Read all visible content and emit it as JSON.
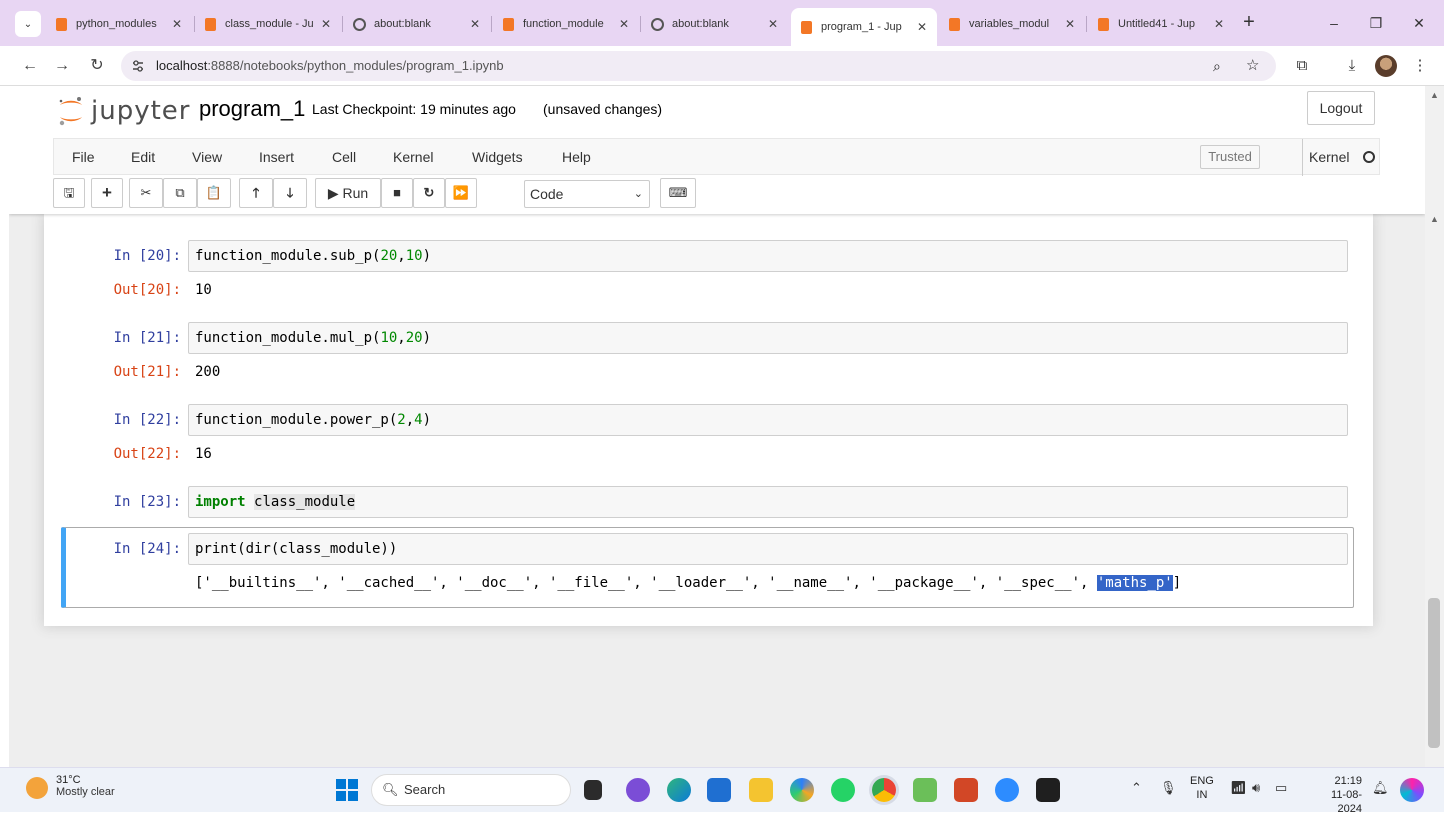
{
  "browser": {
    "tabs": [
      {
        "label": "python_modules",
        "icon": "jupyter-orange-icon"
      },
      {
        "label": "class_module - Ju",
        "icon": "jupyter-orange-icon"
      },
      {
        "label": "about:blank",
        "icon": "globe-icon"
      },
      {
        "label": "function_module",
        "icon": "jupyter-orange-icon"
      },
      {
        "label": "about:blank",
        "icon": "globe-icon"
      },
      {
        "label": "program_1 - Jup",
        "icon": "jupyter-orange-icon",
        "active": true
      },
      {
        "label": "variables_modul",
        "icon": "jupyter-orange-icon"
      },
      {
        "label": "Untitled41 - Jup",
        "icon": "jupyter-orange-icon"
      }
    ],
    "new_tab_symbol": "+",
    "window_controls": {
      "minimize": "–",
      "maximize": "❐",
      "close": "✕"
    },
    "address": {
      "host": "localhost",
      "rest": ":8888/notebooks/python_modules/program_1.ipynb"
    }
  },
  "jupyter": {
    "logo_text": "jupyter",
    "notebook_name": "program_1",
    "checkpoint": "Last Checkpoint: 19 minutes ago",
    "unsaved": "(unsaved changes)",
    "logout_label": "Logout",
    "menu": [
      "File",
      "Edit",
      "View",
      "Insert",
      "Cell",
      "Kernel",
      "Widgets",
      "Help"
    ],
    "trusted_label": "Trusted",
    "kernel_label": "Kernel",
    "toolbar": {
      "run_label": "Run",
      "cell_type": "Code"
    }
  },
  "cells": [
    {
      "in_prompt": "In [20]:",
      "code": "function_module.sub_p(20,10)",
      "out_prompt": "Out[20]:",
      "output": "10"
    },
    {
      "in_prompt": "In [21]:",
      "code": "function_module.mul_p(10,20)",
      "out_prompt": "Out[21]:",
      "output": "200"
    },
    {
      "in_prompt": "In [22]:",
      "code": "function_module.power_p(2,4)",
      "out_prompt": "Out[22]:",
      "output": "16"
    },
    {
      "in_prompt": "In [23]:",
      "code_kw": "import",
      "code_name": "class_module"
    },
    {
      "in_prompt": "In [24]:",
      "code": "print(dir(class_module))",
      "output_prefix": "['__builtins__', '__cached__', '__doc__', '__file__', '__loader__', '__name__', '__package__', '__spec__', ",
      "output_selected": "'maths_p'",
      "output_suffix": "]"
    }
  ],
  "taskbar": {
    "weather_temp": "31°C",
    "weather_cond": "Mostly clear",
    "search_label": "Search",
    "lang_top": "ENG",
    "lang_bottom": "IN",
    "time": "21:19",
    "date": "11-08-2024"
  }
}
